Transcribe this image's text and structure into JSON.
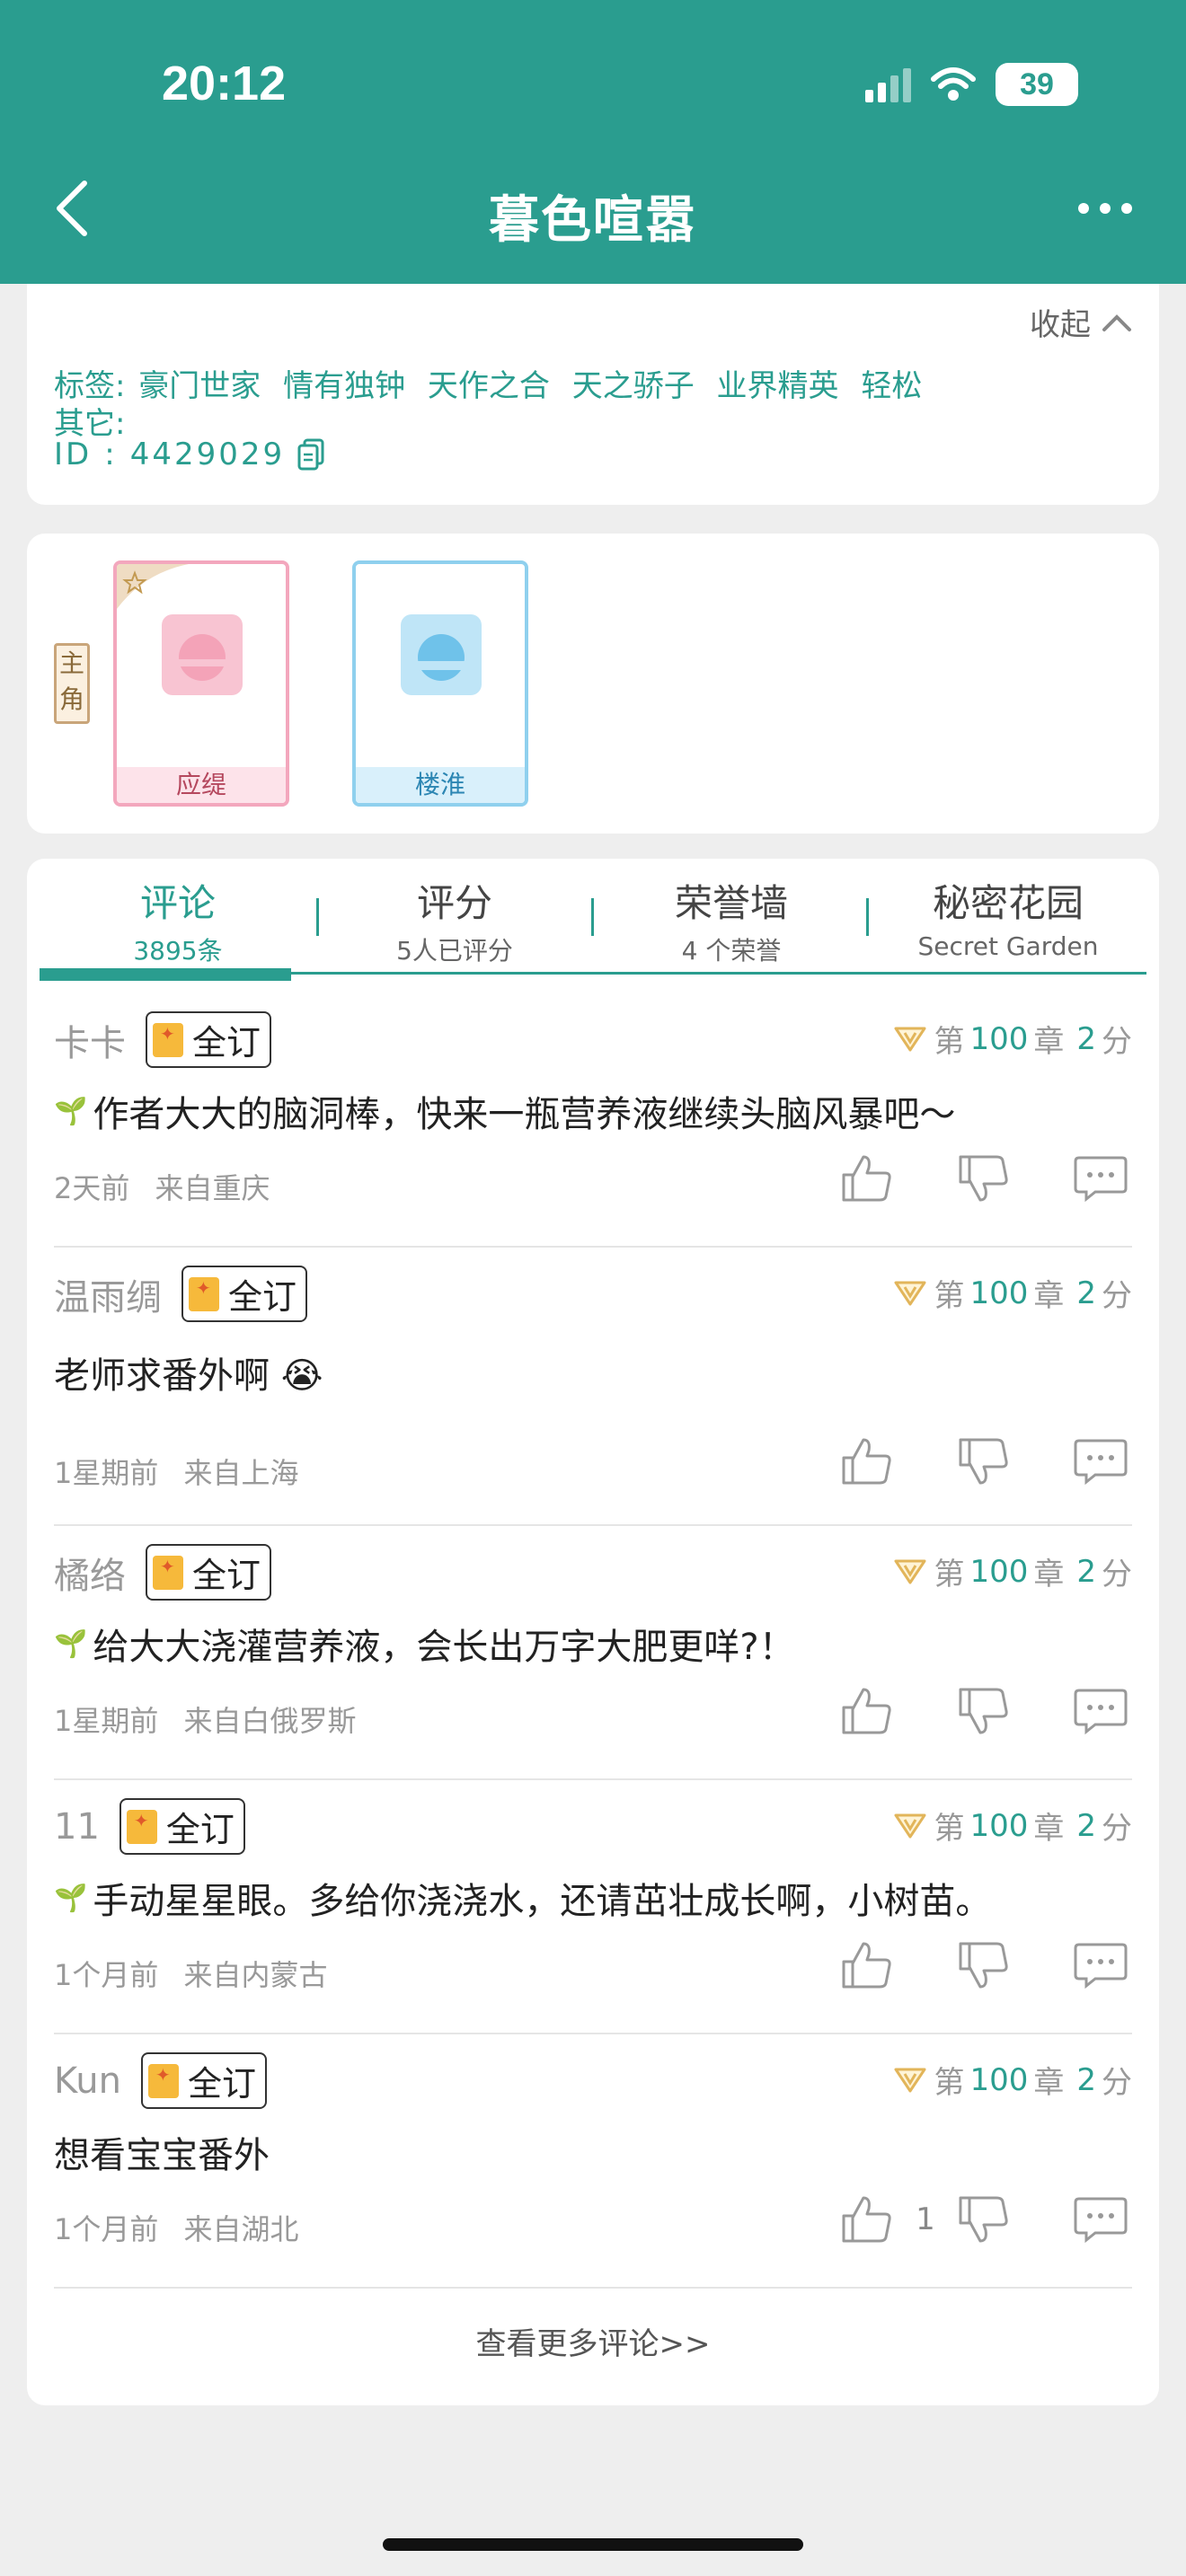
{
  "status": {
    "time": "20:12",
    "battery": "39"
  },
  "header": {
    "title": "暮色喧嚣"
  },
  "info": {
    "collapse_label": "收起",
    "tags_label": "标签:",
    "tags": [
      "豪门世家",
      "情有独钟",
      "天作之合",
      "天之骄子",
      "业界精英",
      "轻松"
    ],
    "other_label": "其它:",
    "id_label": "ID",
    "id_sep": ":",
    "id_value": "4429029"
  },
  "roles": {
    "badge": "主角",
    "items": [
      {
        "name": "应缇"
      },
      {
        "name": "楼淮"
      }
    ]
  },
  "tabs": [
    {
      "label": "评论",
      "sub": "3895条"
    },
    {
      "label": "评分",
      "sub": "5人已评分"
    },
    {
      "label": "荣誉墙",
      "sub": "4 个荣誉"
    },
    {
      "label": "秘密花园",
      "sub": "Secret Garden"
    }
  ],
  "comments": [
    {
      "user": "卡卡",
      "badge": "全订",
      "ch_prefix": "第",
      "chapter": "100",
      "ch_mid": "章",
      "score": "2",
      "score_unit": "分",
      "text": "作者大大的脑洞棒，快来一瓶营养液继续头脑风暴吧～",
      "time": "2天前",
      "location": "来自重庆",
      "likes": ""
    },
    {
      "user": "温雨绸",
      "badge": "全订",
      "ch_prefix": "第",
      "chapter": "100",
      "ch_mid": "章",
      "score": "2",
      "score_unit": "分",
      "text": "老师求番外啊 😭",
      "time": "1星期前",
      "location": "来自上海",
      "likes": ""
    },
    {
      "user": "橘络",
      "badge": "全订",
      "ch_prefix": "第",
      "chapter": "100",
      "ch_mid": "章",
      "score": "2",
      "score_unit": "分",
      "text": "给大大浇灌营养液，会长出万字大肥更咩?！",
      "time": "1星期前",
      "location": "来自白俄罗斯",
      "likes": ""
    },
    {
      "user": "11",
      "badge": "全订",
      "ch_prefix": "第",
      "chapter": "100",
      "ch_mid": "章",
      "score": "2",
      "score_unit": "分",
      "text": "手动星星眼。多给你浇浇水，还请茁壮成长啊，小树苗。",
      "time": "1个月前",
      "location": "来自内蒙古",
      "likes": ""
    },
    {
      "user": "Kun",
      "badge": "全订",
      "ch_prefix": "第",
      "chapter": "100",
      "ch_mid": "章",
      "score": "2",
      "score_unit": "分",
      "text": "想看宝宝番外",
      "time": "1个月前",
      "location": "来自湖北",
      "likes": "1"
    }
  ],
  "more_comments": "查看更多评论>>"
}
